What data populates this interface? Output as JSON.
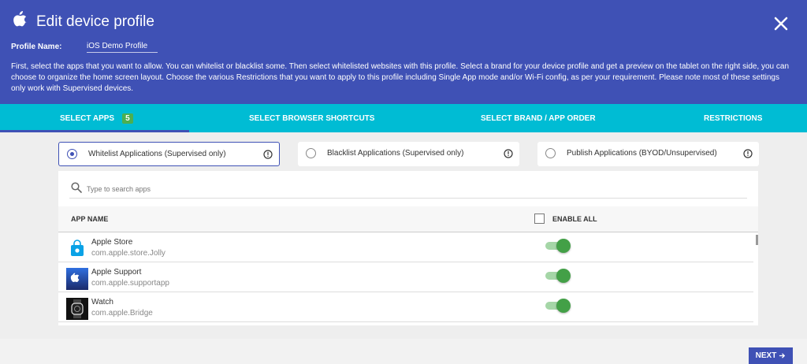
{
  "header": {
    "title": "Edit device profile",
    "profile_name_label": "Profile Name:",
    "profile_name_value": "iOS Demo Profile",
    "description": "First, select the apps that you want to allow. You can whitelist or blacklist some. Then select whitelisted websites with this profile. Select a brand for your device profile and get a preview on the tablet on the right side, you can choose to organize the home screen layout. Choose the various Restrictions that you want to apply to this profile including Single App mode and/or Wi-Fi config, as per your requirement. Please note most of these settings only work with Supervised devices.",
    "icons": {
      "brand": "apple-icon",
      "close": "close-icon"
    },
    "background_color": "#3f51b5"
  },
  "tabs": {
    "items": [
      {
        "label": "SELECT APPS",
        "badge": "5",
        "active": true
      },
      {
        "label": "SELECT BROWSER SHORTCUTS"
      },
      {
        "label": "SELECT BRAND / APP ORDER"
      },
      {
        "label": "RESTRICTIONS"
      }
    ],
    "background_color": "#00bcd4",
    "badge_color": "#4caf50"
  },
  "modes": [
    {
      "label": "Whitelist Applications (Supervised only)",
      "selected": true,
      "icon": "info-icon"
    },
    {
      "label": "Blacklist Applications (Supervised only)",
      "selected": false,
      "icon": "info-icon"
    },
    {
      "label": "Publish Applications (BYOD/Unsupervised)",
      "selected": false,
      "icon": "info-icon"
    }
  ],
  "search": {
    "placeholder": "Type to search apps",
    "icon": "search-icon"
  },
  "table": {
    "col_app_name": "APP NAME",
    "col_enable_all": "ENABLE ALL",
    "enable_all_checked": false,
    "rows": [
      {
        "name": "Apple Store",
        "package": "com.apple.store.Jolly",
        "enabled": true,
        "icon": "apple-store-app-icon"
      },
      {
        "name": "Apple Support",
        "package": "com.apple.supportapp",
        "enabled": true,
        "icon": "apple-support-app-icon"
      },
      {
        "name": "Watch",
        "package": "com.apple.Bridge",
        "enabled": true,
        "icon": "watch-app-icon"
      }
    ]
  },
  "footer": {
    "next_label": "NEXT",
    "next_icon": "arrow-right-icon"
  }
}
